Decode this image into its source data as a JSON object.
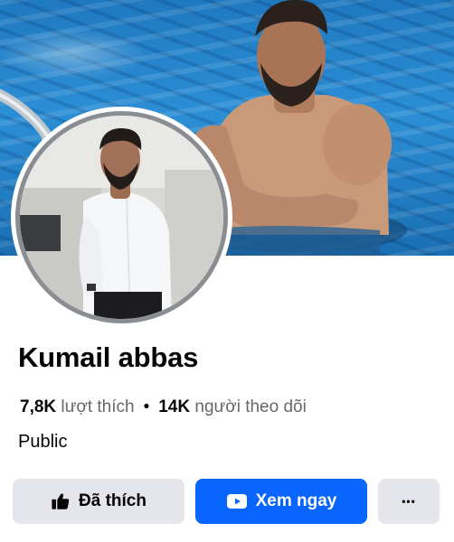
{
  "page": {
    "name": "Kumail abbas",
    "category": "Public"
  },
  "stats": {
    "likes_count": "7,8K",
    "likes_label": "lượt thích",
    "separator": "•",
    "followers_count": "14K",
    "followers_label": "người theo dõi"
  },
  "actions": {
    "liked_label": "Đã thích",
    "watch_label": "Xem ngay",
    "more_label": "•••"
  },
  "images": {
    "cover": "cover-photo-man-in-swimming-pool",
    "profile": "profile-photo-man-in-white-shirt"
  },
  "colors": {
    "primary_blue": "#0866ff",
    "secondary_button": "#e4e6eb",
    "muted_text": "#65676b"
  }
}
